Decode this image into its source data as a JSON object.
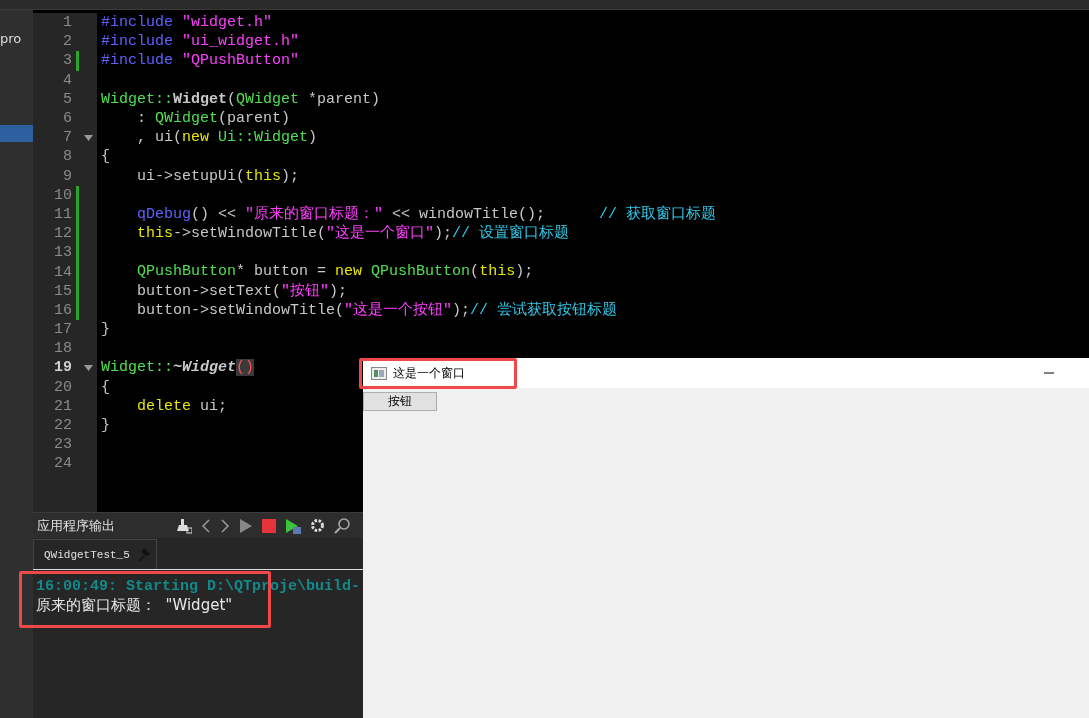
{
  "sidebar": {
    "items": [
      {
        "label": "pro",
        "selected": false
      },
      {
        "selected": true
      }
    ]
  },
  "editor": {
    "lines": [
      {
        "number": "1",
        "changed": false,
        "fold": false,
        "current": false,
        "indent": false,
        "segs": [
          {
            "kind": "pp",
            "t": "#include "
          },
          {
            "kind": "str",
            "t": "\"widget.h\""
          }
        ]
      },
      {
        "number": "2",
        "changed": false,
        "fold": false,
        "current": false,
        "indent": false,
        "segs": [
          {
            "kind": "pp",
            "t": "#include "
          },
          {
            "kind": "str",
            "t": "\"ui_widget.h\""
          }
        ]
      },
      {
        "number": "3",
        "changed": true,
        "fold": false,
        "current": false,
        "indent": false,
        "segs": [
          {
            "kind": "pp",
            "t": "#include "
          },
          {
            "kind": "str",
            "t": "\"QPushButton\""
          }
        ]
      },
      {
        "number": "4",
        "changed": false,
        "fold": false,
        "current": false
      },
      {
        "number": "5",
        "changed": false,
        "fold": false,
        "current": false,
        "indent": false,
        "segs": [
          {
            "kind": "type",
            "t": "Widget::"
          },
          {
            "kind": "bold",
            "t": "Widget"
          },
          {
            "kind": "plain",
            "t": "("
          },
          {
            "kind": "type",
            "t": "QWidget"
          },
          {
            "kind": "plain",
            "t": " *parent)"
          }
        ]
      },
      {
        "number": "6",
        "changed": false,
        "fold": false,
        "current": false,
        "indent": true,
        "segs": [
          {
            "kind": "plain",
            "t": ": "
          },
          {
            "kind": "type",
            "t": "QWidget"
          },
          {
            "kind": "plain",
            "t": "(parent)"
          }
        ]
      },
      {
        "number": "7",
        "changed": false,
        "fold": true,
        "current": false,
        "indent": true,
        "segs": [
          {
            "kind": "plain",
            "t": ", ui("
          },
          {
            "kind": "kw",
            "t": "new"
          },
          {
            "kind": "type",
            "t": " Ui::Widget"
          },
          {
            "kind": "plain",
            "t": ")"
          }
        ]
      },
      {
        "number": "8",
        "changed": false,
        "fold": false,
        "current": false,
        "indent": false,
        "segs": [
          {
            "kind": "plain",
            "t": "{"
          }
        ]
      },
      {
        "number": "9",
        "changed": false,
        "fold": false,
        "current": false,
        "indent": true,
        "segs": [
          {
            "kind": "plain",
            "t": "ui->setupUi("
          },
          {
            "kind": "kw",
            "t": "this"
          },
          {
            "kind": "plain",
            "t": ");"
          }
        ]
      },
      {
        "number": "10",
        "changed": true,
        "fold": false,
        "current": false
      },
      {
        "number": "11",
        "changed": true,
        "fold": false,
        "current": false,
        "indent": true,
        "segs": [
          {
            "kind": "macro",
            "t": "qDebug"
          },
          {
            "kind": "plain",
            "t": "() << "
          },
          {
            "kind": "str",
            "t": "\"原来的窗口标题：\""
          },
          {
            "kind": "plain",
            "t": " << windowTitle();"
          },
          {
            "kind": "comment",
            "t": "      // 获取窗口标题"
          }
        ]
      },
      {
        "number": "12",
        "changed": true,
        "fold": false,
        "current": false,
        "indent": true,
        "segs": [
          {
            "kind": "kw",
            "t": "this"
          },
          {
            "kind": "plain",
            "t": "->setWindowTitle("
          },
          {
            "kind": "str",
            "t": "\"这是一个窗口\""
          },
          {
            "kind": "plain",
            "t": ");"
          },
          {
            "kind": "comment",
            "t": "// 设置窗口标题"
          }
        ]
      },
      {
        "number": "13",
        "changed": true,
        "fold": false,
        "current": false
      },
      {
        "number": "14",
        "changed": true,
        "fold": false,
        "current": false,
        "indent": true,
        "segs": [
          {
            "kind": "type",
            "t": "QPushButton"
          },
          {
            "kind": "plain",
            "t": "* button = "
          },
          {
            "kind": "kw",
            "t": "new"
          },
          {
            "kind": "type",
            "t": " QPushButton"
          },
          {
            "kind": "plain",
            "t": "("
          },
          {
            "kind": "kw",
            "t": "this"
          },
          {
            "kind": "plain",
            "t": ");"
          }
        ]
      },
      {
        "number": "15",
        "changed": true,
        "fold": false,
        "current": false,
        "indent": true,
        "segs": [
          {
            "kind": "plain",
            "t": "button->setText("
          },
          {
            "kind": "str",
            "t": "\"按钮\""
          },
          {
            "kind": "plain",
            "t": ");"
          }
        ]
      },
      {
        "number": "16",
        "changed": true,
        "fold": false,
        "current": false,
        "indent": true,
        "segs": [
          {
            "kind": "plain",
            "t": "button->setWindowTitle("
          },
          {
            "kind": "str",
            "t": "\"这是一个按钮\""
          },
          {
            "kind": "plain",
            "t": ");"
          },
          {
            "kind": "comment",
            "t": "// 尝试获取按钮标题"
          }
        ]
      },
      {
        "number": "17",
        "changed": false,
        "fold": false,
        "current": false,
        "indent": false,
        "segs": [
          {
            "kind": "plain",
            "t": "}"
          }
        ]
      },
      {
        "number": "18",
        "changed": false,
        "fold": false,
        "current": false
      },
      {
        "number": "19",
        "changed": false,
        "fold": true,
        "current": true,
        "indent": false,
        "segs": [
          {
            "kind": "type",
            "t": "Widget::"
          },
          {
            "kind": "bolditalic",
            "t": "~Widget"
          },
          {
            "kind": "match",
            "t": "()"
          }
        ]
      },
      {
        "number": "20",
        "changed": false,
        "fold": false,
        "current": false,
        "indent": false,
        "segs": [
          {
            "kind": "plain",
            "t": "{"
          }
        ]
      },
      {
        "number": "21",
        "changed": false,
        "fold": false,
        "current": false,
        "indent": true,
        "segs": [
          {
            "kind": "kw",
            "t": "delete"
          },
          {
            "kind": "plain",
            "t": " ui;"
          }
        ]
      },
      {
        "number": "22",
        "changed": false,
        "fold": false,
        "current": false,
        "indent": false,
        "segs": [
          {
            "kind": "plain",
            "t": "}"
          }
        ]
      },
      {
        "number": "23",
        "changed": false,
        "fold": false,
        "current": false
      },
      {
        "number": "24",
        "changed": false,
        "fold": false,
        "current": false
      }
    ]
  },
  "output": {
    "title": "应用程序输出",
    "tabs": [
      {
        "label": "QWidgetTest_5",
        "selected": true
      }
    ],
    "lines": [
      {
        "kind": "status",
        "text": "16:00:49: Starting D:\\QTproje\\build-"
      },
      {
        "kind": "plain",
        "text": "原来的窗口标题：  \"Widget\""
      }
    ],
    "highlighted": true
  },
  "window": {
    "title": "这是一个窗口",
    "title_highlighted": true,
    "button": "按钮"
  }
}
